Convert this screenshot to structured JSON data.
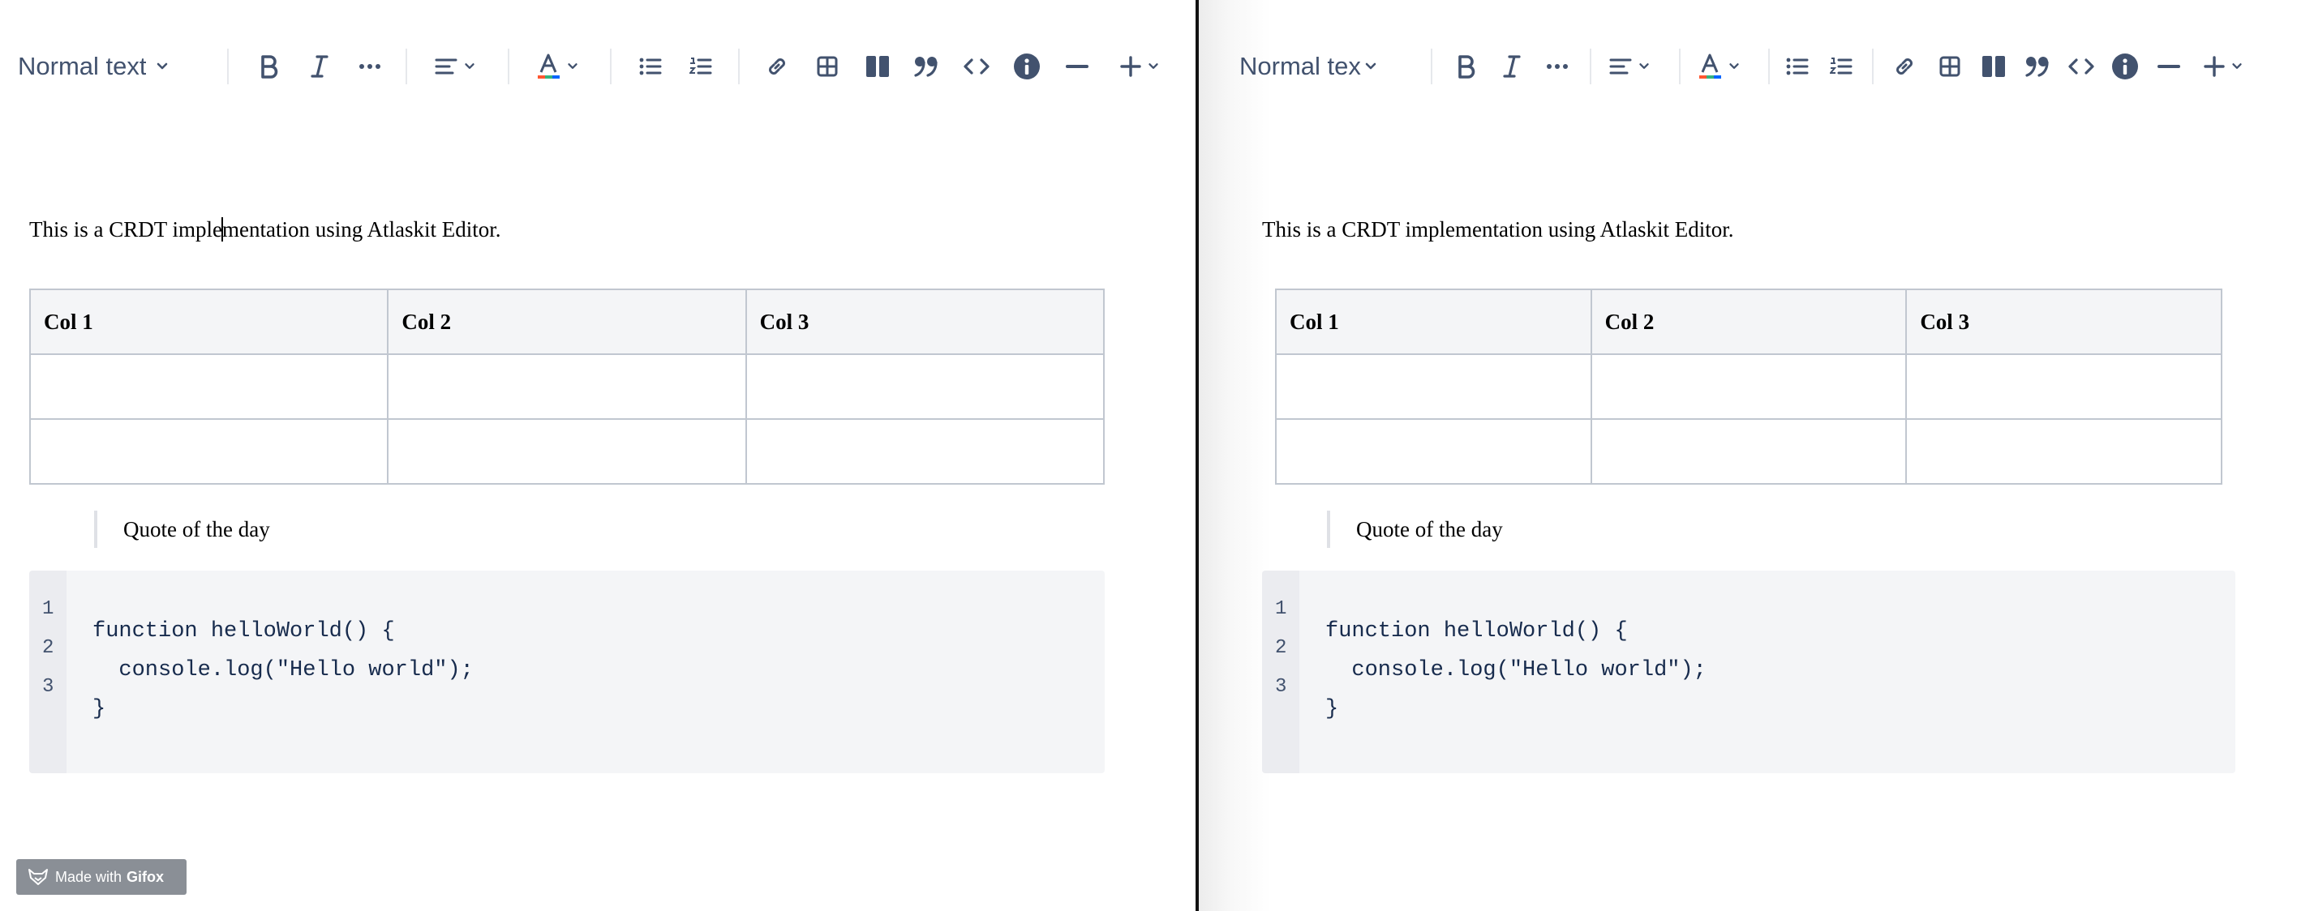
{
  "left": {
    "toolbar": {
      "text_style": "Normal text"
    },
    "paragraph_before_caret": "This is a CRDT imple",
    "paragraph_after_caret": "mentation using Atlaskit Editor.",
    "table": {
      "headers": [
        "Col 1",
        "Col 2",
        "Col 3"
      ]
    },
    "quote": "Quote of the day",
    "code": {
      "line_numbers": [
        "1",
        "2",
        "3"
      ],
      "lines": [
        "function helloWorld() {",
        "  console.log(\"Hello world\");",
        "}"
      ]
    }
  },
  "right": {
    "toolbar": {
      "text_style": "Normal text"
    },
    "paragraph": "This is a CRDT implementation using Atlaskit Editor.",
    "table": {
      "headers": [
        "Col 1",
        "Col 2",
        "Col 3"
      ]
    },
    "quote": "Quote of the day",
    "code": {
      "line_numbers": [
        "1",
        "2",
        "3"
      ],
      "lines": [
        "function helloWorld() {",
        "  console.log(\"Hello world\");",
        "}"
      ]
    }
  },
  "watermark": {
    "prefix": "Made with",
    "brand": "Gifox"
  },
  "colors": {
    "toolbar_icon": "#42526e",
    "border": "#c1c7d0",
    "header_bg": "#f4f5f7",
    "code_bg": "#f4f5f7",
    "gutter_bg": "#ebecf0",
    "divider": "#111111"
  }
}
